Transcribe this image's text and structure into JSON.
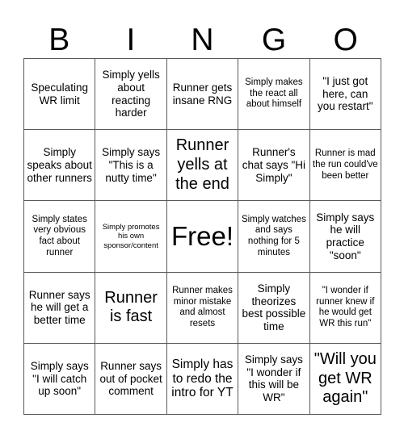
{
  "card": {
    "type": "bingo-card",
    "columns": 5,
    "rows": 5,
    "header_letters": [
      "B",
      "I",
      "N",
      "G",
      "O"
    ],
    "border_color": "#5a5a5a",
    "background_color": "#ffffff",
    "text_color": "#000000",
    "cells": [
      {
        "text": "Speculating WR limit",
        "size": "md",
        "free": false
      },
      {
        "text": "Simply yells about reacting harder",
        "size": "md",
        "free": false
      },
      {
        "text": "Runner gets insane RNG",
        "size": "md",
        "free": false
      },
      {
        "text": "Simply makes the react all about himself",
        "size": "sm",
        "free": false
      },
      {
        "text": "\"I just got here, can you restart\"",
        "size": "md",
        "free": false
      },
      {
        "text": "Simply speaks about other runners",
        "size": "md",
        "free": false
      },
      {
        "text": "Simply says \"This is a nutty time\"",
        "size": "md",
        "free": false
      },
      {
        "text": "Runner yells at the end",
        "size": "xl",
        "free": false
      },
      {
        "text": "Runner's chat says \"Hi Simply\"",
        "size": "md",
        "free": false
      },
      {
        "text": "Runner is mad the run could've been better",
        "size": "sm",
        "free": false
      },
      {
        "text": "Simply states very obvious fact about runner",
        "size": "sm",
        "free": false
      },
      {
        "text": "Simply promotes his own sponsor/content",
        "size": "xs",
        "free": false
      },
      {
        "text": "Free!",
        "size": "xxl",
        "free": true
      },
      {
        "text": "Simply watches and says nothing for 5 minutes",
        "size": "sm",
        "free": false
      },
      {
        "text": "Simply says he will practice \"soon\"",
        "size": "md",
        "free": false
      },
      {
        "text": "Runner says he will get a better time",
        "size": "md",
        "free": false
      },
      {
        "text": "Runner is fast",
        "size": "xl",
        "free": false
      },
      {
        "text": "Runner makes minor mistake and almost resets",
        "size": "sm",
        "free": false
      },
      {
        "text": "Simply theorizes best possible time",
        "size": "md",
        "free": false
      },
      {
        "text": "\"I wonder if runner knew if he would get WR this run\"",
        "size": "sm",
        "free": false
      },
      {
        "text": "Simply says \"I will catch up soon\"",
        "size": "md",
        "free": false
      },
      {
        "text": "Runner says out of pocket comment",
        "size": "md",
        "free": false
      },
      {
        "text": "Simply has to redo the intro for YT",
        "size": "lg",
        "free": false
      },
      {
        "text": "Simply says \"I wonder if this will be WR\"",
        "size": "md",
        "free": false
      },
      {
        "text": "\"Will you get WR again\"",
        "size": "xl",
        "free": false
      }
    ]
  }
}
